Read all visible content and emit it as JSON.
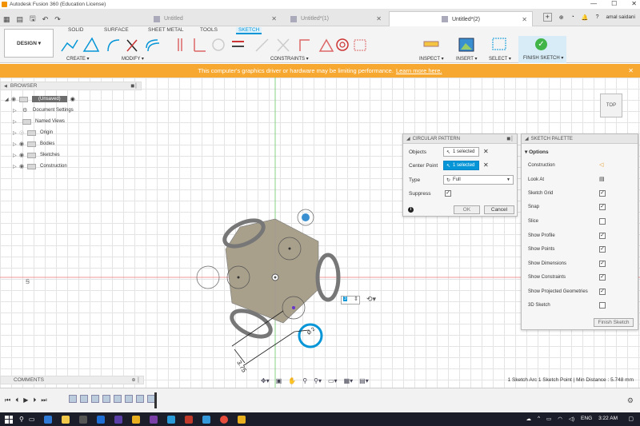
{
  "window": {
    "title": "Autodesk Fusion 360 (Education License)",
    "minimize": "—",
    "maximize": "☐",
    "close": "✕"
  },
  "tabs": [
    {
      "label": "Untitled"
    },
    {
      "label": "Untitled*(1)"
    },
    {
      "label": "Untitled*(2)"
    }
  ],
  "tabbar": {
    "user": "amal saidani",
    "help": "?",
    "new_tab": "+"
  },
  "ribbon": {
    "workspace": "DESIGN ▾",
    "tabs": [
      "SOLID",
      "SURFACE",
      "SHEET METAL",
      "TOOLS",
      "SKETCH"
    ],
    "groups": [
      "CREATE ▾",
      "MODIFY ▾",
      "CONSTRAINTS ▾",
      "INSPECT ▾",
      "INSERT ▾",
      "SELECT ▾",
      "FINISH SKETCH ▾"
    ]
  },
  "warning": {
    "text": "This computer's graphics driver or hardware may be limiting performance.",
    "link": "Learn more here."
  },
  "browser": {
    "title": "BROWSER",
    "items": [
      {
        "label": "(Unsaved)"
      },
      {
        "label": "Document Settings"
      },
      {
        "label": "Named Views"
      },
      {
        "label": "Origin"
      },
      {
        "label": "Bodies"
      },
      {
        "label": "Sketches"
      },
      {
        "label": "Construction"
      }
    ]
  },
  "circular_pattern": {
    "title": "CIRCULAR PATTERN",
    "objects_label": "Objects",
    "objects_value": "1 selected",
    "center_label": "Center Point",
    "center_value": "1 selected",
    "type_label": "Type",
    "type_value": "Full",
    "suppress_label": "Suppress",
    "ok": "OK",
    "cancel": "Cancel",
    "info": "i"
  },
  "sketch_palette": {
    "title": "SKETCH PALETTE",
    "options_title": "▾ Options",
    "options": [
      {
        "label": "Construction",
        "checked": null
      },
      {
        "label": "Look At",
        "checked": null
      },
      {
        "label": "Sketch Grid",
        "checked": true
      },
      {
        "label": "Snap",
        "checked": true
      },
      {
        "label": "Slice",
        "checked": false
      },
      {
        "label": "Show Profile",
        "checked": true
      },
      {
        "label": "Show Points",
        "checked": true
      },
      {
        "label": "Show Dimensions",
        "checked": true
      },
      {
        "label": "Show Constraints",
        "checked": true
      },
      {
        "label": "Show Projected Geometries",
        "checked": true
      },
      {
        "label": "3D Sketch",
        "checked": false
      }
    ],
    "finish": "Finish Sketch"
  },
  "viewcube": {
    "label": "TOP"
  },
  "canvas": {
    "dim_value": "3.75",
    "input_value": "3",
    "dim2": "Ø 2"
  },
  "comments": {
    "title": "COMMENTS"
  },
  "status": {
    "text": "1 Sketch Arc 1 Sketch Point | Min Distance : 5.748 mm"
  },
  "taskbar": {
    "lang": "ENG",
    "time": "3:22 AM"
  },
  "colors": {
    "accent": "#0696d7",
    "warning": "#f7a830",
    "finish": "#41b548"
  }
}
